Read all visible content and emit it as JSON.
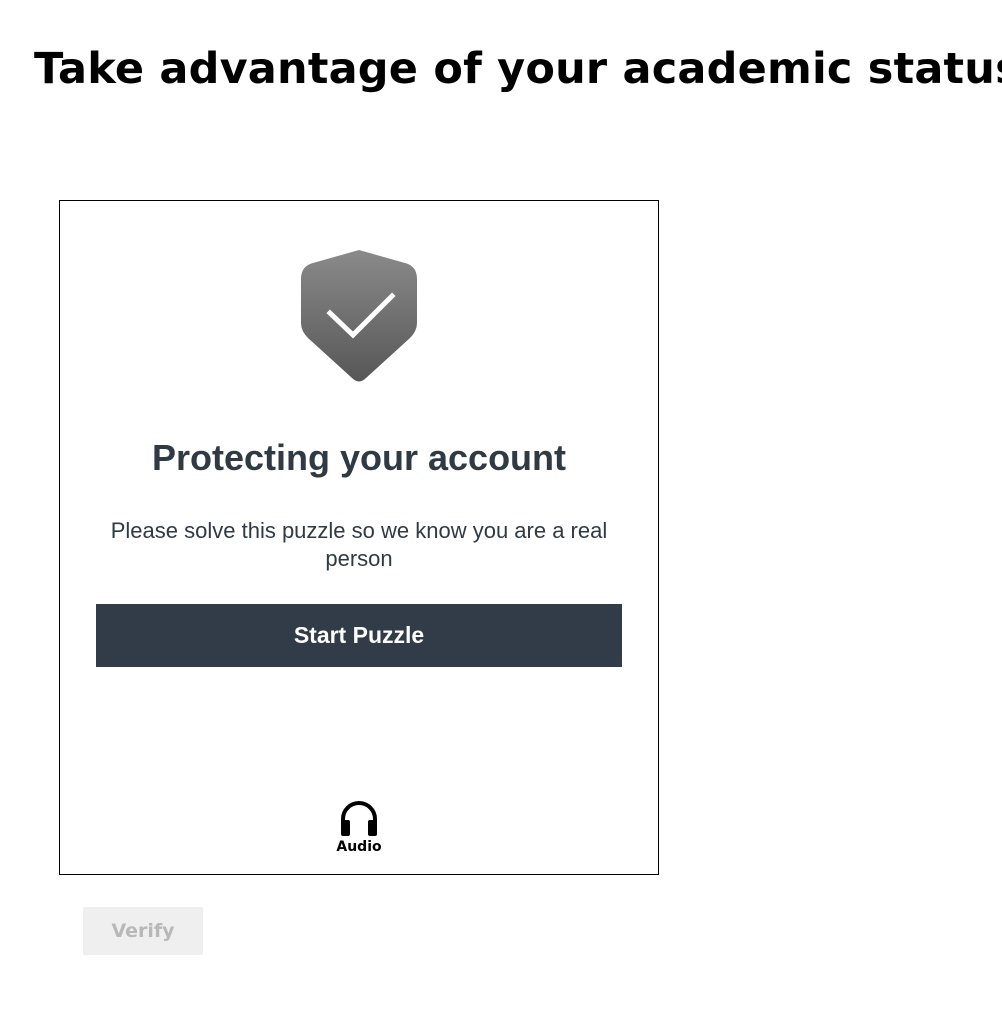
{
  "page": {
    "title": "Take advantage of your academic status"
  },
  "challenge": {
    "icon": "shield-check-icon",
    "heading": "Protecting your account",
    "text": "Please solve this puzzle so we know you are a real person",
    "start_button_label": "Start Puzzle",
    "audio_icon": "headphones-icon",
    "audio_label": "Audio"
  },
  "verify_button_label": "Verify",
  "colors": {
    "heading_text": "#2f3a45",
    "start_button_bg": "#313c48",
    "shield_top": "#8a8a8a",
    "shield_bottom": "#575757",
    "verify_bg": "#efefef",
    "verify_text": "#b8b8b8"
  }
}
